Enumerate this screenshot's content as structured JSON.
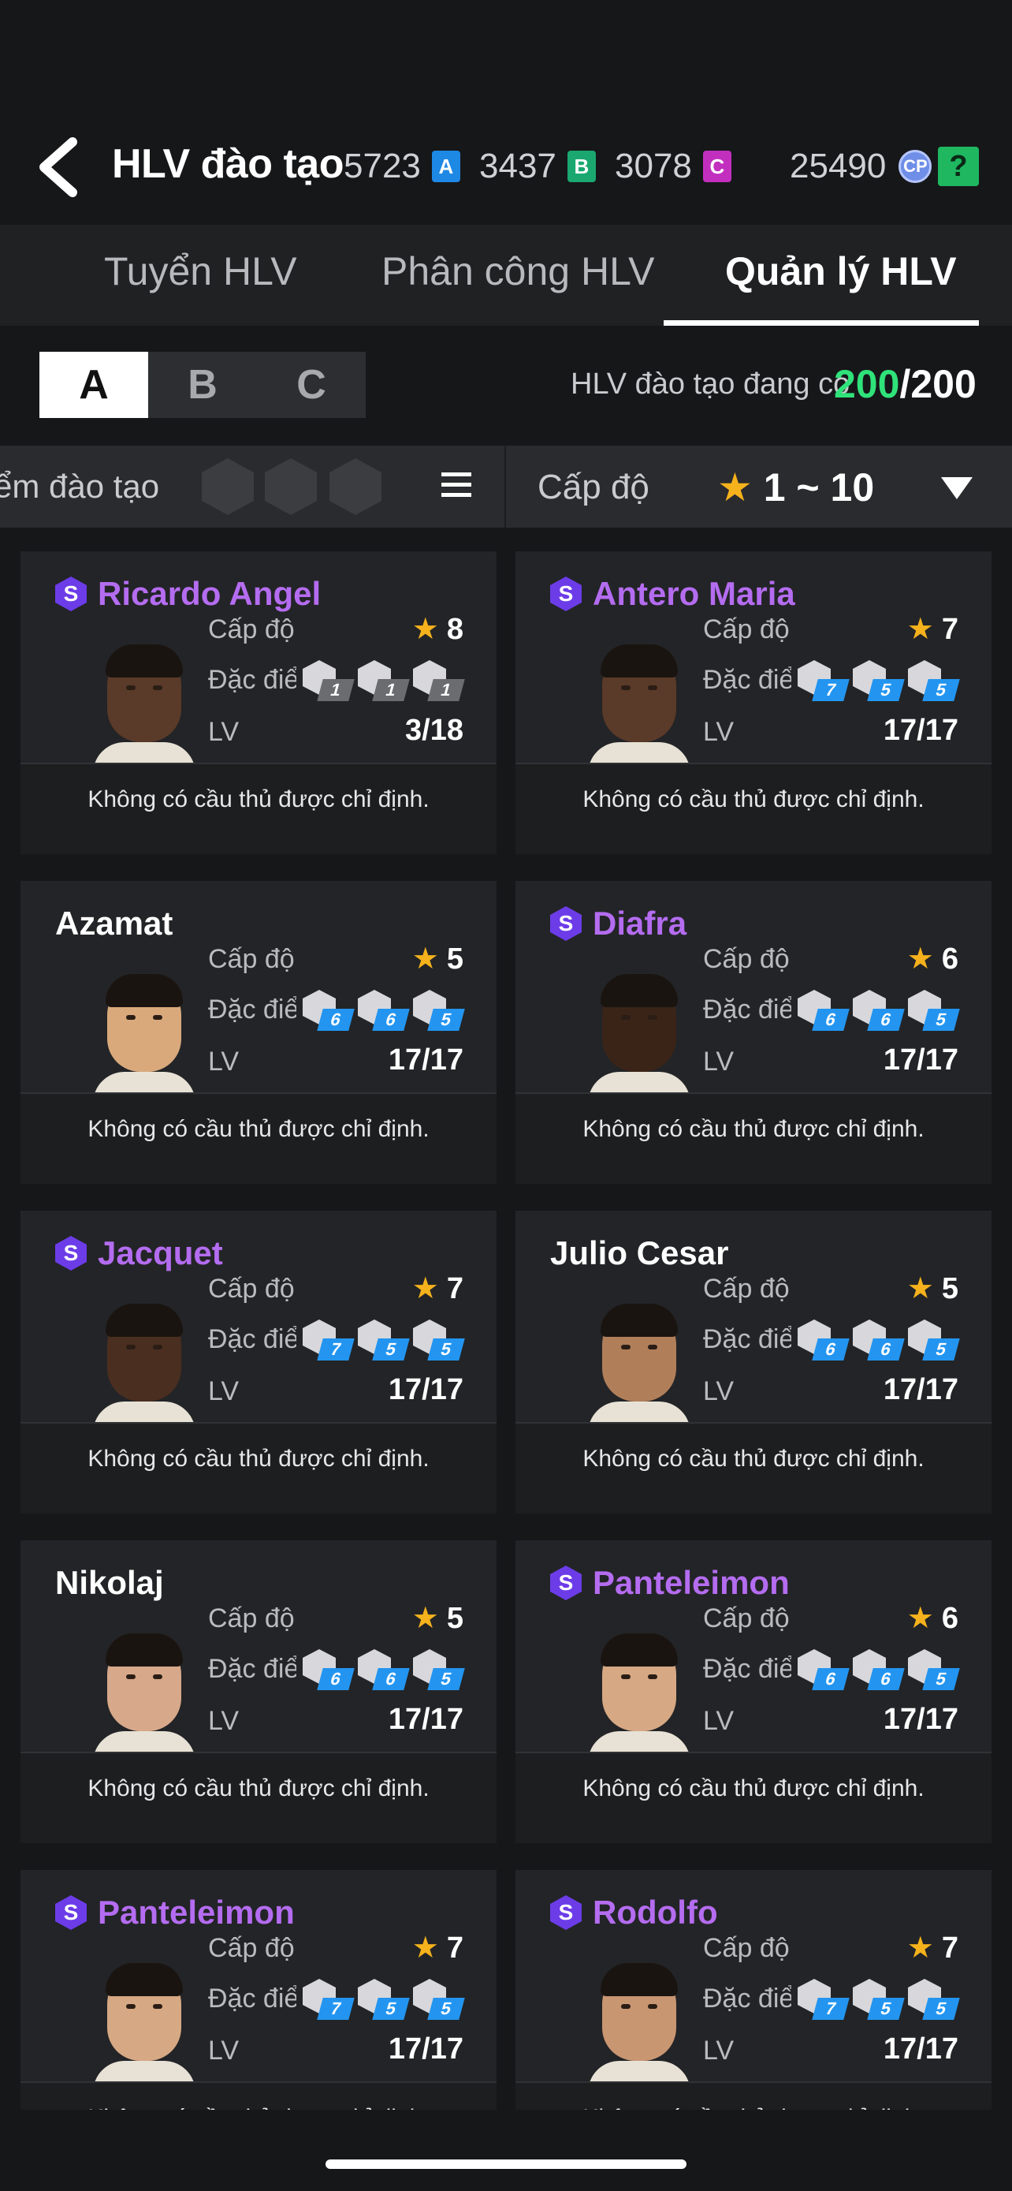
{
  "header": {
    "title": "HLV đào tạo",
    "currencies": [
      {
        "value": "5723",
        "chip": "A",
        "color": "#1e88e5"
      },
      {
        "value": "3437",
        "chip": "B",
        "color": "#1aa870"
      },
      {
        "value": "3078",
        "chip": "C",
        "color": "#c22fbf"
      }
    ],
    "cp_value": "25490",
    "cp_icon_text": "CP",
    "help_text": "?"
  },
  "tabs": [
    {
      "label": "Tuyển HLV",
      "active": false
    },
    {
      "label": "Phân công HLV",
      "active": false
    },
    {
      "label": "Quản lý HLV",
      "active": true
    }
  ],
  "segments": [
    {
      "label": "A",
      "selected": true
    },
    {
      "label": "B",
      "selected": false
    },
    {
      "label": "C",
      "selected": false
    }
  ],
  "coach_count": {
    "label": "HLV đào tạo đang có",
    "current": "200",
    "max": "/200"
  },
  "filters": {
    "trait_label": "ểm đào tạo",
    "level_label": "Cấp độ",
    "level_star": "★",
    "level_range": "1 ~ 10"
  },
  "card_labels": {
    "level": "Cấp độ",
    "traits": "Đặc điểm",
    "lv": "LV",
    "footer": "Không có cầu thủ được chỉ định."
  },
  "coaches": [
    {
      "name": "Ricardo Angel",
      "special": true,
      "stars": "8",
      "lv": "3/18",
      "traits": [
        "1",
        "1",
        "1"
      ],
      "trait_grey": true,
      "skin": "#5a3a28"
    },
    {
      "name": "Antero Maria",
      "special": true,
      "stars": "7",
      "lv": "17/17",
      "traits": [
        "7",
        "5",
        "5"
      ],
      "trait_grey": false,
      "skin": "#5a3a28"
    },
    {
      "name": "Azamat",
      "special": false,
      "stars": "5",
      "lv": "17/17",
      "traits": [
        "6",
        "6",
        "5"
      ],
      "trait_grey": false,
      "skin": "#d9a97c"
    },
    {
      "name": "Diafra",
      "special": true,
      "stars": "6",
      "lv": "17/17",
      "traits": [
        "6",
        "6",
        "5"
      ],
      "trait_grey": false,
      "skin": "#3a2418"
    },
    {
      "name": "Jacquet",
      "special": true,
      "stars": "7",
      "lv": "17/17",
      "traits": [
        "7",
        "5",
        "5"
      ],
      "trait_grey": false,
      "skin": "#4a2e20"
    },
    {
      "name": "Julio Cesar",
      "special": false,
      "stars": "5",
      "lv": "17/17",
      "traits": [
        "6",
        "6",
        "5"
      ],
      "trait_grey": false,
      "skin": "#b07f5a"
    },
    {
      "name": "Nikolaj",
      "special": false,
      "stars": "5",
      "lv": "17/17",
      "traits": [
        "6",
        "6",
        "5"
      ],
      "trait_grey": false,
      "skin": "#d7a88a"
    },
    {
      "name": "Panteleimon",
      "special": true,
      "stars": "6",
      "lv": "17/17",
      "traits": [
        "6",
        "6",
        "5"
      ],
      "trait_grey": false,
      "skin": "#d6a883"
    },
    {
      "name": "Panteleimon",
      "special": true,
      "stars": "7",
      "lv": "17/17",
      "traits": [
        "7",
        "5",
        "5"
      ],
      "trait_grey": false,
      "skin": "#d6a883"
    },
    {
      "name": "Rodolfo",
      "special": true,
      "stars": "7",
      "lv": "17/17",
      "traits": [
        "7",
        "5",
        "5"
      ],
      "trait_grey": false,
      "skin": "#c99672"
    }
  ],
  "special_badge": "S"
}
